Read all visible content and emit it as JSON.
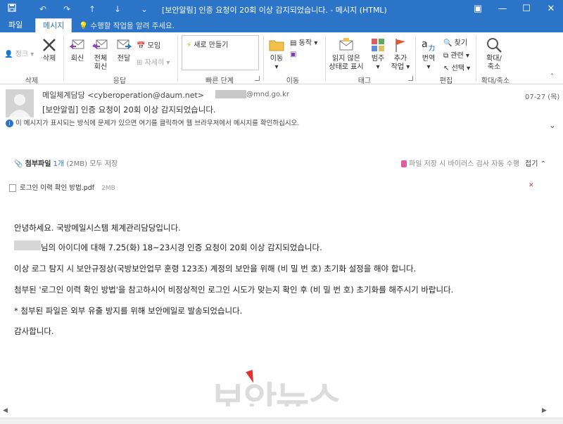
{
  "titlebar": {
    "title": "[보안알림] 인증 요청이 20회 이상 감지되었습니다. - 메시지 (HTML)",
    "quick_access": [
      "save-icon",
      "undo-icon",
      "redo-icon",
      "up-arrow-icon",
      "down-arrow-icon",
      "customize-icon"
    ],
    "window_buttons": [
      "ribbon-options-icon",
      "minimize-icon",
      "maximize-icon",
      "close-icon"
    ],
    "colors": {
      "bar": "#2b74c7"
    }
  },
  "tabs": {
    "file": "파일",
    "message": "메시지",
    "tell_me": "수행할 작업을 알려 주세요."
  },
  "ribbon": {
    "delete_group": {
      "junk": "정크",
      "delete": "삭제",
      "label": "삭제"
    },
    "respond_group": {
      "reply": "회신",
      "reply_all_1": "전체",
      "reply_all_2": "회신",
      "forward": "전달",
      "meeting": "모임",
      "more": "자세히",
      "label": "응답"
    },
    "quick_steps": {
      "new": "새로 만들기",
      "label": "빠른 단계"
    },
    "move_group": {
      "move": "이동",
      "rules": "동작",
      "label": "이동"
    },
    "tags_group": {
      "unread_1": "읽지 않은",
      "unread_2": "상태로 표시",
      "categorize": "범주",
      "followup_1": "추가",
      "followup_2": "작업",
      "label": "태그"
    },
    "edit_group": {
      "translate": "번역",
      "find": "찾기",
      "related": "관련",
      "select": "선택",
      "label": "편집"
    },
    "zoom_group": {
      "zoom_1": "확대/",
      "zoom_2": "축소",
      "label": "확대/축소"
    }
  },
  "header": {
    "sender": "메일체계담당 <cyberoperation@daum.net>",
    "recipient": "@mnd.go.kr",
    "date": "07-27 (목)",
    "subject": "[보안알림] 인증 요청이 20회 이상 감지되었습니다.",
    "info": "이 메시지가 표시되는 방식에 문제가 있으면 여기를 클릭하여 웹 브라우저에서 메시지를 확인하십시오."
  },
  "attachments": {
    "label": "첨부파일",
    "count": "1개",
    "size_total": "(2MB)",
    "save_all": "모두 저장",
    "virus_note": "파일 저장 시 바이러스 검사 자동 수행",
    "fold": "접기",
    "files": [
      {
        "name": "로그인 이력 확인 방법.pdf",
        "size": "2MB"
      }
    ]
  },
  "body": {
    "lines": [
      "안녕하세요. 국방메일시스템 체계관리담당입니다.",
      "님의 아이디에 대해 7.25(화) 18~23시경 인증 요청이 20회 이상 감지되었습니다.",
      "이상 로그 탐지 시 보안규정상(국방보안업무 훈령 123조) 계정의 보안을 위해 (비 밀 번 호) 초기화 설정을 해야 합니다.",
      "첨부된 '로그인 이력 확인 방법'을 참고하시어 비정상적인 로그인 시도가 맞는지 확인 후 (비 밀 번 호) 초기화를 해주시기 바랍니다.",
      "* 첨부된 파일은 외부 유출 방지를 위해 보안메일로 발송되었습니다.",
      "감사합니다."
    ]
  },
  "watermark": "보안뉴스"
}
